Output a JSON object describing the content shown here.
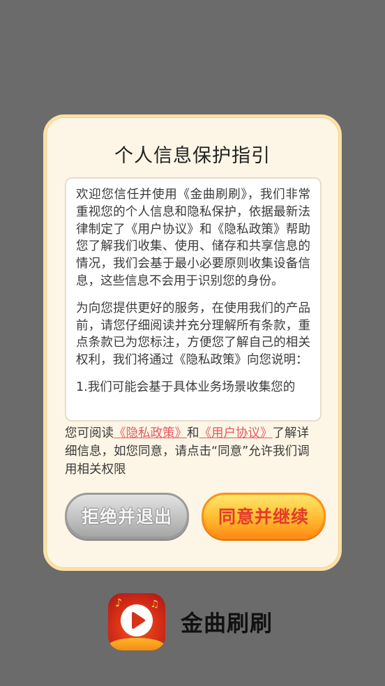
{
  "dialog": {
    "title": "个人信息保护指引",
    "paragraphs": [
      "欢迎您信任并使用《金曲刷刷》，我们非常重视您的个人信息和隐私保护，依据最新法律制定了《用户协议》和《隐私政策》帮助您了解我们收集、使用、储存和共享信息的情况，我们会基于最小必要原则收集设备信息，这些信息不会用于识别您的身份。",
      "为向您提供更好的服务，在使用我们的产品前，请您仔细阅读并充分理解所有条款，重点条款已为您标注，方便您了解自己的相关权利，我们将通过《隐私政策》向您说明：",
      "1.我们可能会基于具体业务场景收集您的"
    ],
    "notice": {
      "prefix": "您可阅读",
      "privacy_link": "《隐私政策》",
      "and": "和",
      "agreement_link": "《用户协议》",
      "suffix": "了解详细信息，如您同意，请点击“同意”允许我们调用相关权限"
    },
    "buttons": {
      "reject": "拒绝并退出",
      "agree": "同意并继续"
    }
  },
  "brand": {
    "app_name": "金曲刷刷",
    "icon": "play-music-icon"
  },
  "colors": {
    "overlay": "#6b6b6b",
    "dialog_bg": "#fdf6e6",
    "dialog_border": "#ffe0a6",
    "link": "#e8585e",
    "agree_text": "#e43b2b",
    "agree_button": "#ffb82c",
    "reject_button": "#c2c2c2"
  }
}
